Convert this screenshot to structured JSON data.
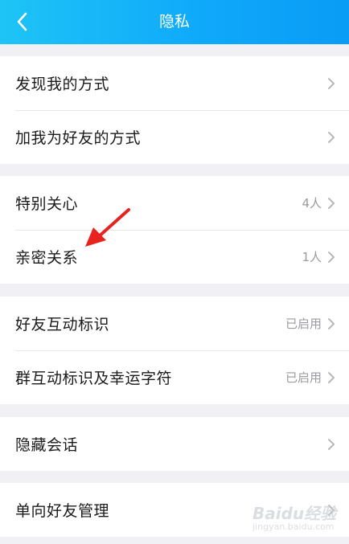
{
  "header": {
    "title": "隐私"
  },
  "groups": [
    {
      "items": [
        {
          "label": "发现我的方式",
          "value": ""
        },
        {
          "label": "加我为好友的方式",
          "value": ""
        }
      ]
    },
    {
      "items": [
        {
          "label": "特别关心",
          "value": "4人"
        },
        {
          "label": "亲密关系",
          "value": "1人"
        }
      ]
    },
    {
      "items": [
        {
          "label": "好友互动标识",
          "value": "已启用"
        },
        {
          "label": "群互动标识及幸运字符",
          "value": "已启用"
        }
      ]
    },
    {
      "items": [
        {
          "label": "隐藏会话",
          "value": ""
        }
      ]
    },
    {
      "items": [
        {
          "label": "单向好友管理",
          "value": ""
        }
      ]
    }
  ],
  "watermark": {
    "text": "Baidu经验",
    "sub": "jingyan.baidu.com"
  },
  "colors": {
    "header_start": "#1ec4f6",
    "header_end": "#0a9cf6",
    "annotation_arrow": "#e8231f"
  }
}
